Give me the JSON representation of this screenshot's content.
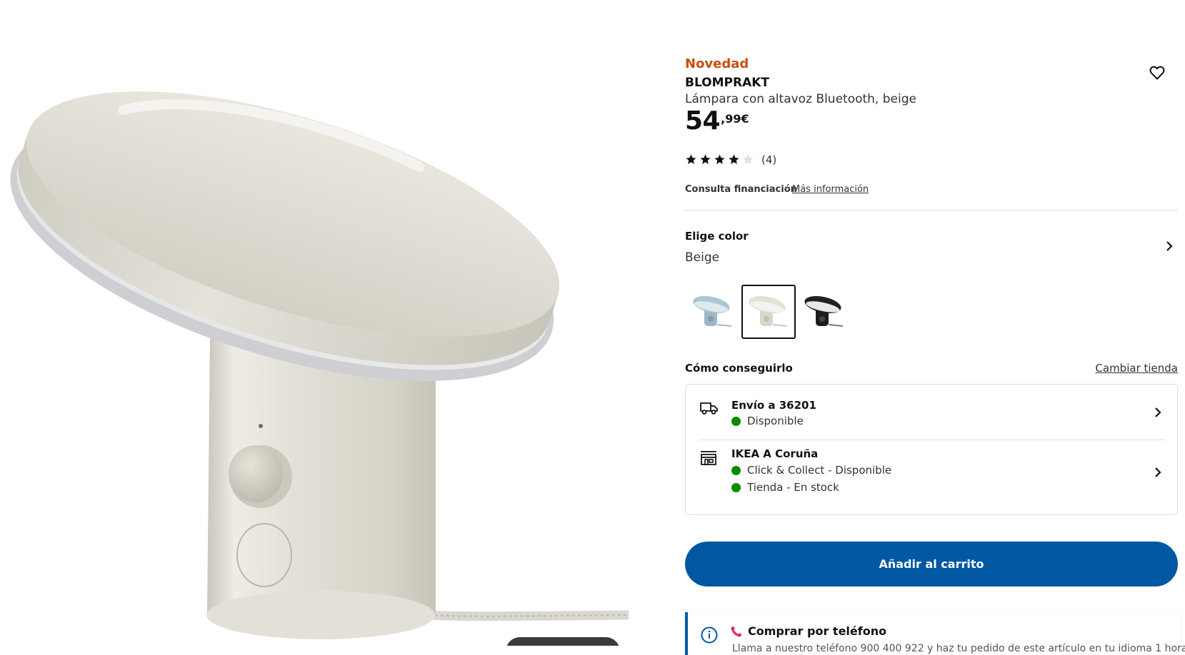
{
  "product": {
    "badge": "Novedad",
    "name": "BLOMPRAKT",
    "description": "Lámpara con altavoz Bluetooth, beige",
    "price_integer": "54",
    "price_decimal": ",99€",
    "rating": 4,
    "rating_max": 5,
    "review_count": "(4)"
  },
  "financing": {
    "label": "Consulta financiación",
    "link": "Más información"
  },
  "color": {
    "title": "Elige color",
    "selected": "Beige",
    "options": [
      "blue-lamp",
      "beige-lamp",
      "black-lamp"
    ]
  },
  "delivery": {
    "title": "Cómo conseguirlo",
    "change_store": "Cambiar tienda",
    "shipping_title": "Envío a 36201",
    "shipping_status": "Disponible",
    "store_title": "IKEA A Coruña",
    "store_collect": "Click & Collect - Disponible",
    "store_stock": "Tienda - En stock"
  },
  "cart": {
    "label": "Añadir al carrito"
  },
  "phone": {
    "title": "Comprar por teléfono",
    "description": "Llama a nuestro teléfono 900 400 922 y haz tu pedido de este artículo en tu idioma 1 hora"
  },
  "colors": {
    "badge": "#c94f0e",
    "primary": "#0058a3",
    "available": "#0a8a00",
    "phone_icon": "#e0245e"
  }
}
